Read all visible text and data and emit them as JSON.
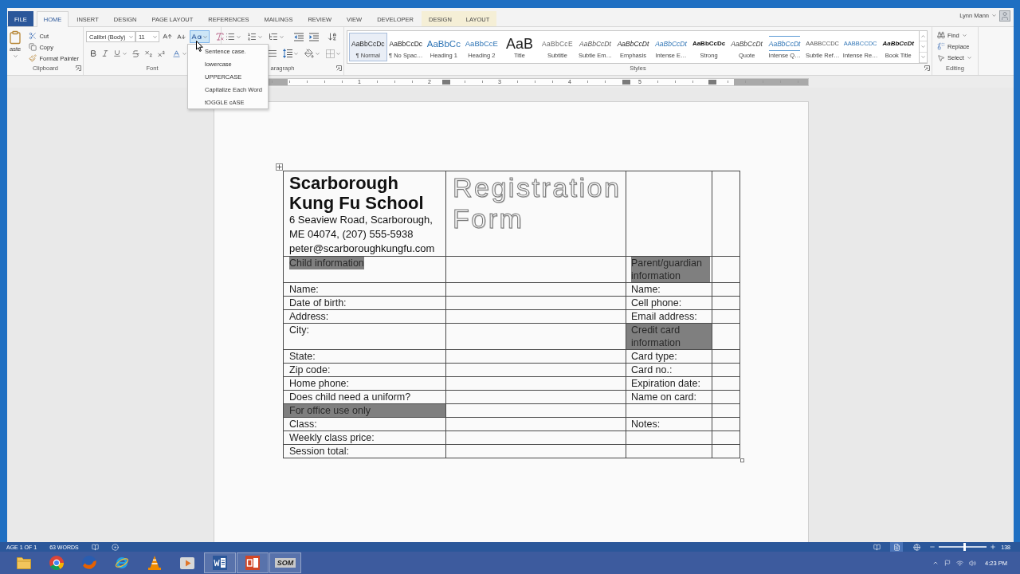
{
  "ribbon_tabs": [
    {
      "label": "FILE",
      "kind": "file",
      "selected": false
    },
    {
      "label": "HOME",
      "kind": "normal",
      "selected": true
    },
    {
      "label": "INSERT",
      "kind": "normal",
      "selected": false
    },
    {
      "label": "DESIGN",
      "kind": "normal",
      "selected": false
    },
    {
      "label": "PAGE LAYOUT",
      "kind": "normal",
      "selected": false
    },
    {
      "label": "REFERENCES",
      "kind": "normal",
      "selected": false
    },
    {
      "label": "MAILINGS",
      "kind": "normal",
      "selected": false
    },
    {
      "label": "REVIEW",
      "kind": "normal",
      "selected": false
    },
    {
      "label": "VIEW",
      "kind": "normal",
      "selected": false
    },
    {
      "label": "DEVELOPER",
      "kind": "normal",
      "selected": false
    },
    {
      "label": "DESIGN",
      "kind": "contextual",
      "selected": false
    },
    {
      "label": "LAYOUT",
      "kind": "contextual",
      "selected": false
    }
  ],
  "user": {
    "name": "Lynn Mann"
  },
  "clipboard": {
    "label": "Clipboard",
    "paste": "aste",
    "cut": "Cut",
    "copy": "Copy",
    "format_painter": "Format Painter"
  },
  "font": {
    "label": "Font",
    "name": "Calibri (Body)",
    "size": "11",
    "case_menu": {
      "open": true,
      "items": [
        "Sentence case.",
        "lowercase",
        "UPPERCASE",
        "Capitalize Each Word",
        "tOGGLE cASE"
      ]
    }
  },
  "paragraph": {
    "label": "aragraph"
  },
  "styles": {
    "label": "Styles",
    "items": [
      {
        "preview": "AaBbCcDc",
        "name": "¶ Normal",
        "kind": "plain",
        "selected": true
      },
      {
        "preview": "AaBbCcDc",
        "name": "¶ No Spac…",
        "kind": "plain",
        "selected": false
      },
      {
        "preview": "AaBbCc",
        "name": "Heading 1",
        "kind": "heading1",
        "selected": false
      },
      {
        "preview": "AaBbCcE",
        "name": "Heading 2",
        "kind": "heading2",
        "selected": false
      },
      {
        "preview": "AaB",
        "name": "Title",
        "kind": "title",
        "selected": false
      },
      {
        "preview": "AaBbCcE",
        "name": "Subtitle",
        "kind": "subtitle",
        "selected": false
      },
      {
        "preview": "AaBbCcDt",
        "name": "Subtle Em…",
        "kind": "subtle",
        "selected": false
      },
      {
        "preview": "AaBbCcDt",
        "name": "Emphasis",
        "kind": "emphasis",
        "selected": false
      },
      {
        "preview": "AaBbCcDt",
        "name": "Intense E…",
        "kind": "intense",
        "selected": false
      },
      {
        "preview": "AaBbCcDc",
        "name": "Strong",
        "kind": "strong",
        "selected": false
      },
      {
        "preview": "AaBbCcDt",
        "name": "Quote",
        "kind": "quote",
        "selected": false
      },
      {
        "preview": "AaBbCcDt",
        "name": "Intense Q…",
        "kind": "intensequote",
        "selected": false
      },
      {
        "preview": "AABBCCDC",
        "name": "Subtle Ref…",
        "kind": "smallcaps",
        "selected": false
      },
      {
        "preview": "AABBCCDC",
        "name": "Intense Re…",
        "kind": "bluecaps",
        "selected": false
      },
      {
        "preview": "AaBbCcDt",
        "name": "Book Title",
        "kind": "booktitle",
        "selected": false
      }
    ]
  },
  "editing": {
    "label": "Editing",
    "find": "Find",
    "replace": "Replace",
    "select": "Select"
  },
  "ruler": {
    "numbers": [
      "1",
      "2",
      "3",
      "4",
      "5"
    ]
  },
  "document": {
    "header": {
      "school_name": "Scarborough Kung Fu School",
      "address_lines": [
        "6 Seaview Road, Scarborough,",
        "ME 04074, (207) 555-5938"
      ],
      "email": "peter@scarboroughkungfu.com",
      "form_title": "Registration Form"
    },
    "rows": [
      {
        "left": {
          "text": "Child information",
          "kind": "highlighted"
        },
        "right": {
          "text": "Parent/guardian information",
          "kind": "highlighted"
        }
      },
      {
        "left": {
          "text": "Name:",
          "kind": "label"
        },
        "right": {
          "text": "Name:",
          "kind": "label"
        }
      },
      {
        "left": {
          "text": "Date of birth:",
          "kind": "label"
        },
        "right": {
          "text": "Cell phone:",
          "kind": "label"
        }
      },
      {
        "left": {
          "text": "Address:",
          "kind": "label"
        },
        "right": {
          "text": "Email address:",
          "kind": "label"
        }
      },
      {
        "left": {
          "text": "City:",
          "kind": "label"
        },
        "right": {
          "text": "Credit card information",
          "kind": "shaded"
        }
      },
      {
        "left": {
          "text": "State:",
          "kind": "label"
        },
        "right": {
          "text": "Card type:",
          "kind": "label"
        }
      },
      {
        "left": {
          "text": "Zip code:",
          "kind": "label"
        },
        "right": {
          "text": "Card no.:",
          "kind": "label"
        }
      },
      {
        "left": {
          "text": "Home phone:",
          "kind": "label"
        },
        "right": {
          "text": "Expiration date:",
          "kind": "label"
        }
      },
      {
        "left": {
          "text": "Does child need a uniform?",
          "kind": "label"
        },
        "right": {
          "text": "Name on card:",
          "kind": "label"
        }
      },
      {
        "left": {
          "text": "For office use only",
          "kind": "shaded"
        }
      },
      {
        "left": {
          "text": "Class:",
          "kind": "label"
        },
        "right": {
          "text": "Notes:",
          "kind": "label"
        }
      },
      {
        "left": {
          "text": "Weekly class price:",
          "kind": "label"
        }
      },
      {
        "left": {
          "text": "Session total:",
          "kind": "label"
        }
      }
    ]
  },
  "status_bar": {
    "page": "AGE 1 OF 1",
    "words": "63 WORDS",
    "views": [
      {
        "kind": "read",
        "selected": false
      },
      {
        "kind": "print",
        "selected": true
      },
      {
        "kind": "web",
        "selected": false
      }
    ],
    "zoom": {
      "level": 0.52,
      "reading": "138"
    }
  },
  "taskbar": {
    "apps": [
      {
        "kind": "folder",
        "open": false
      },
      {
        "kind": "roundlogo",
        "open": false
      },
      {
        "kind": "foxlogo",
        "open": false
      },
      {
        "kind": "ringlogo",
        "open": false
      },
      {
        "kind": "cone",
        "open": false
      },
      {
        "kind": "player",
        "open": false
      },
      {
        "kind": "document",
        "open": true
      },
      {
        "kind": "slides",
        "open": true
      },
      {
        "kind": "text",
        "label": "SOM",
        "open": true
      }
    ],
    "time": "4:23 PM"
  }
}
